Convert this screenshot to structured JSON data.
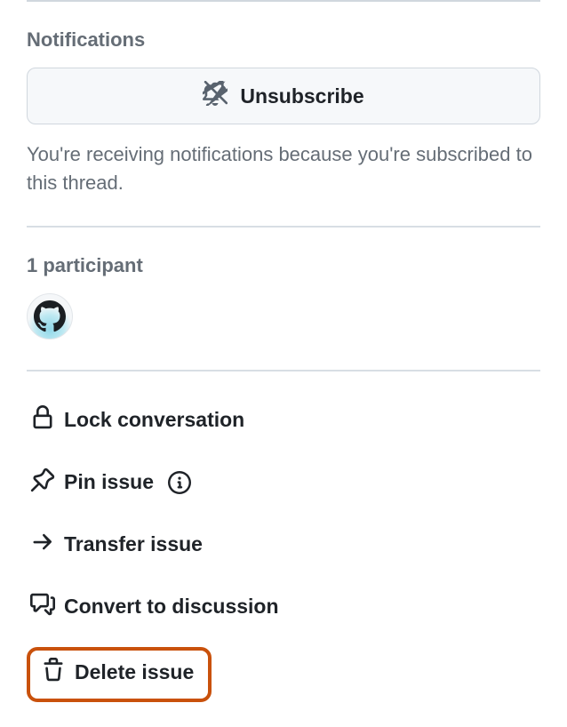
{
  "notifications": {
    "heading": "Notifications",
    "button_label": "Unsubscribe",
    "description": "You're receiving notifications because you're subscribed to this thread."
  },
  "participants": {
    "heading": "1 participant"
  },
  "actions": {
    "lock": "Lock conversation",
    "pin": "Pin issue",
    "transfer": "Transfer issue",
    "convert": "Convert to discussion",
    "delete": "Delete issue"
  }
}
